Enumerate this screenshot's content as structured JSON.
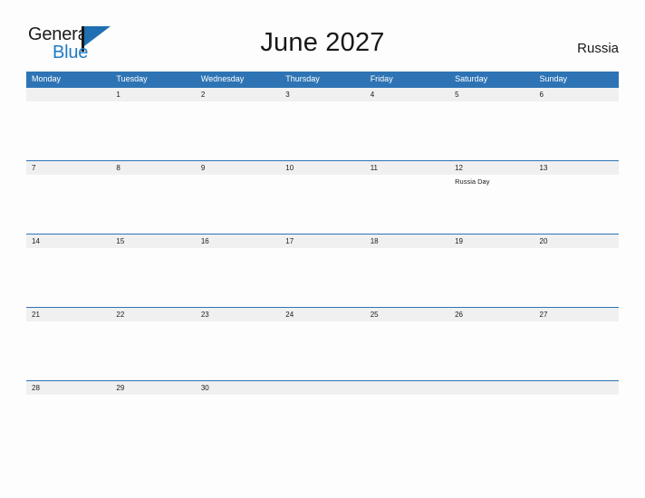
{
  "brand": {
    "name_part1": "General",
    "name_part2": "Blue",
    "flag_icon": "flag-triangle-icon",
    "color_dark": "#17181a",
    "color_blue": "#1f7bc4"
  },
  "header": {
    "title": "June 2027",
    "region": "Russia"
  },
  "theme": {
    "header_blue": "#2e74b5",
    "day_band_gray": "#f0f0f0",
    "page_background": "#fdfdfd",
    "text_dark": "#1a1a1a"
  },
  "calendar": {
    "month": "June",
    "year": "2027",
    "country": "Russia",
    "weekdays": [
      "Monday",
      "Tuesday",
      "Wednesday",
      "Thursday",
      "Friday",
      "Saturday",
      "Sunday"
    ],
    "weeks": [
      {
        "days": [
          {
            "number": "",
            "event": ""
          },
          {
            "number": "1",
            "event": ""
          },
          {
            "number": "2",
            "event": ""
          },
          {
            "number": "3",
            "event": ""
          },
          {
            "number": "4",
            "event": ""
          },
          {
            "number": "5",
            "event": ""
          },
          {
            "number": "6",
            "event": ""
          }
        ]
      },
      {
        "days": [
          {
            "number": "7",
            "event": ""
          },
          {
            "number": "8",
            "event": ""
          },
          {
            "number": "9",
            "event": ""
          },
          {
            "number": "10",
            "event": ""
          },
          {
            "number": "11",
            "event": ""
          },
          {
            "number": "12",
            "event": "Russia Day"
          },
          {
            "number": "13",
            "event": ""
          }
        ]
      },
      {
        "days": [
          {
            "number": "14",
            "event": ""
          },
          {
            "number": "15",
            "event": ""
          },
          {
            "number": "16",
            "event": ""
          },
          {
            "number": "17",
            "event": ""
          },
          {
            "number": "18",
            "event": ""
          },
          {
            "number": "19",
            "event": ""
          },
          {
            "number": "20",
            "event": ""
          }
        ]
      },
      {
        "days": [
          {
            "number": "21",
            "event": ""
          },
          {
            "number": "22",
            "event": ""
          },
          {
            "number": "23",
            "event": ""
          },
          {
            "number": "24",
            "event": ""
          },
          {
            "number": "25",
            "event": ""
          },
          {
            "number": "26",
            "event": ""
          },
          {
            "number": "27",
            "event": ""
          }
        ]
      },
      {
        "days": [
          {
            "number": "28",
            "event": ""
          },
          {
            "number": "29",
            "event": ""
          },
          {
            "number": "30",
            "event": ""
          },
          {
            "number": "",
            "event": ""
          },
          {
            "number": "",
            "event": ""
          },
          {
            "number": "",
            "event": ""
          },
          {
            "number": "",
            "event": ""
          }
        ]
      }
    ]
  }
}
